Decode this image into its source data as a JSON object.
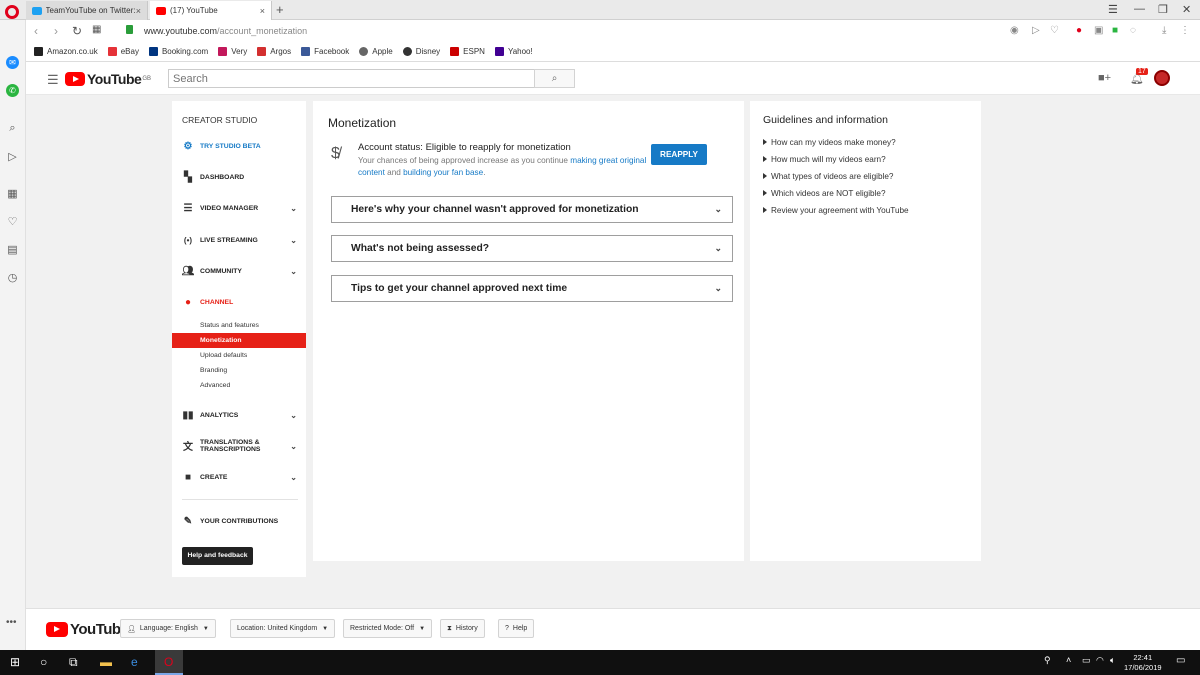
{
  "browser": {
    "tabs": [
      {
        "label": "TeamYouTube on Twitter: \"",
        "active": false,
        "icon": "twitter-icon"
      },
      {
        "label": "(17) YouTube",
        "active": true,
        "icon": "youtube-icon"
      }
    ],
    "url_host": "www.youtube.com",
    "url_path": "/account_monetization",
    "bookmarks": [
      "Amazon.co.uk",
      "eBay",
      "Booking.com",
      "Very",
      "Argos",
      "Facebook",
      "Apple",
      "Disney",
      "ESPN",
      "Yahoo!"
    ]
  },
  "header": {
    "logo_text": "YouTube",
    "region": "GB",
    "search_placeholder": "Search",
    "notification_count": "17"
  },
  "sidebar": {
    "heading": "CREATOR STUDIO",
    "items": [
      {
        "label": "TRY STUDIO BETA",
        "icon": "gear-icon",
        "accent": "#167ac6"
      },
      {
        "label": "DASHBOARD",
        "icon": "dashboard-icon"
      },
      {
        "label": "VIDEO MANAGER",
        "icon": "video-manager-icon"
      },
      {
        "label": "LIVE STREAMING",
        "icon": "live-icon"
      },
      {
        "label": "COMMUNITY",
        "icon": "people-icon"
      },
      {
        "label": "CHANNEL",
        "icon": "account-icon",
        "accent": "#e62117"
      }
    ],
    "channel_subitems": [
      "Status and features",
      "Monetization",
      "Upload defaults",
      "Branding",
      "Advanced"
    ],
    "active_subitem": "Monetization",
    "more_items": [
      {
        "label": "ANALYTICS",
        "icon": "bar-chart-icon"
      },
      {
        "label": "TRANSLATIONS &",
        "label2": "TRANSCRIPTIONS",
        "icon": "translate-icon"
      },
      {
        "label": "CREATE",
        "icon": "camera-icon"
      }
    ],
    "contributions": "YOUR CONTRIBUTIONS",
    "help_button": "Help and feedback"
  },
  "main": {
    "title": "Monetization",
    "status_label": "Account status: Eligible to reapply for monetization",
    "desc_pre": "Your chances of being approved increase as you continue ",
    "desc_link1": "making great original content",
    "desc_mid": " and ",
    "desc_link2": "building your fan base",
    "desc_end": ".",
    "reapply_label": "REAPPLY",
    "accordions": [
      "Here's why your channel wasn't approved for monetization",
      "What's not being assessed?",
      "Tips to get your channel approved next time"
    ]
  },
  "guidelines": {
    "title": "Guidelines and information",
    "links": [
      "How can my videos make money?",
      "How much will my videos earn?",
      "What types of videos are eligible?",
      "Which videos are NOT eligible?",
      "Review your agreement with YouTube"
    ]
  },
  "footer": {
    "language": "Language: English",
    "location": "Location: United Kingdom",
    "restricted": "Restricted Mode: Off",
    "history": "History",
    "help": "Help"
  },
  "taskbar": {
    "time": "22:41",
    "date": "17/06/2019"
  },
  "colors": {
    "brand_red": "#ff0000",
    "active_red": "#e62117",
    "link_blue": "#167ac6"
  }
}
